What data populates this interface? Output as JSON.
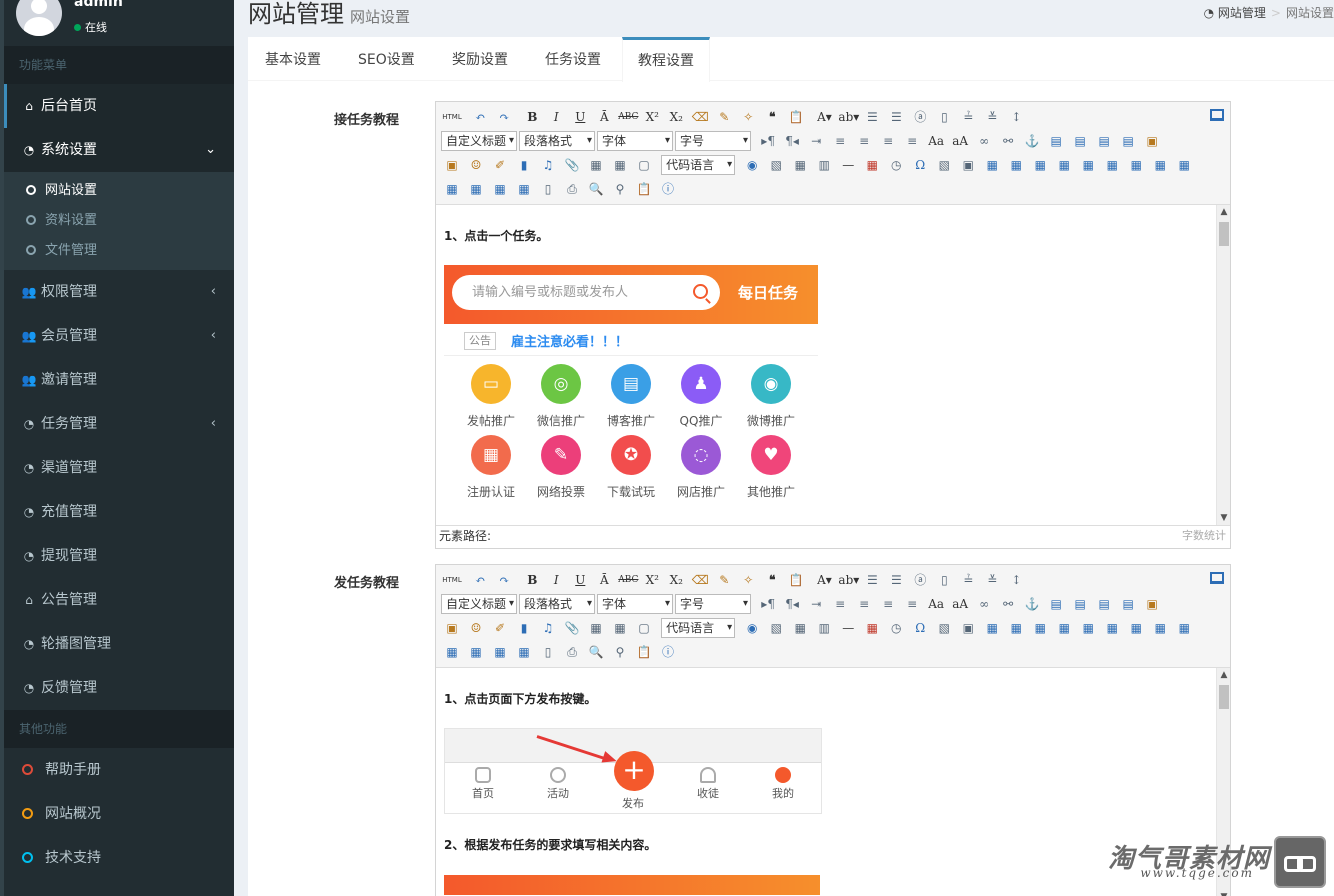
{
  "user": {
    "name": "admin",
    "status": "在线"
  },
  "sidebar": {
    "menu_header": "功能菜单",
    "items": [
      {
        "label": "后台首页",
        "icon": "home-icon"
      },
      {
        "label": "系统设置",
        "icon": "dashboard-icon"
      },
      {
        "label": "权限管理",
        "icon": "users-icon"
      },
      {
        "label": "会员管理",
        "icon": "users-icon"
      },
      {
        "label": "邀请管理",
        "icon": "users-icon"
      },
      {
        "label": "任务管理",
        "icon": "dashboard-icon"
      },
      {
        "label": "渠道管理",
        "icon": "dashboard-icon"
      },
      {
        "label": "充值管理",
        "icon": "dashboard-icon"
      },
      {
        "label": "提现管理",
        "icon": "dashboard-icon"
      },
      {
        "label": "公告管理",
        "icon": "home-icon"
      },
      {
        "label": "轮播图管理",
        "icon": "dashboard-icon"
      },
      {
        "label": "反馈管理",
        "icon": "dashboard-icon"
      }
    ],
    "subitems": [
      "网站设置",
      "资料设置",
      "文件管理"
    ],
    "other_header": "其他功能",
    "other": [
      {
        "label": "帮助手册",
        "color": "#dd4b39"
      },
      {
        "label": "网站概况",
        "color": "#f39c12"
      },
      {
        "label": "技术支持",
        "color": "#00c0ef"
      }
    ]
  },
  "page": {
    "title": "网站管理",
    "subtitle": "网站设置"
  },
  "breadcrumb": {
    "root": "网站管理",
    "current": "网站设置"
  },
  "tabs": [
    "基本设置",
    "SEO设置",
    "奖励设置",
    "任务设置",
    "教程设置"
  ],
  "editor_common": {
    "selects": [
      "自定义标题",
      "段落格式",
      "字体",
      "字号",
      "代码语言"
    ],
    "path_label": "元素路径:",
    "count_label": "字数统计",
    "html_label": "HTML"
  },
  "editor1": {
    "label": "接任务教程",
    "step1": "1、点击一个任务。",
    "search_placeholder": "请输入编号或标题或发布人",
    "daily": "每日任务",
    "notice_tag": "公告",
    "notice_text": "雇主注意必看！！！",
    "grid": [
      {
        "label": "发帖推广",
        "color": "#f7b52c"
      },
      {
        "label": "微信推广",
        "color": "#6cc644"
      },
      {
        "label": "博客推广",
        "color": "#3a9fe6"
      },
      {
        "label": "QQ推广",
        "color": "#8b5cf6"
      },
      {
        "label": "微博推广",
        "color": "#37b8c6"
      },
      {
        "label": "注册认证",
        "color": "#f26b4c"
      },
      {
        "label": "网络投票",
        "color": "#ec3f7a"
      },
      {
        "label": "下载试玩",
        "color": "#f24d4d"
      },
      {
        "label": "网店推广",
        "color": "#9b59d6"
      },
      {
        "label": "其他推广",
        "color": "#f0457a"
      }
    ]
  },
  "editor2": {
    "label": "发任务教程",
    "step1": "1、点击页面下方发布按键。",
    "nav": [
      "首页",
      "活动",
      "发布",
      "收徒",
      "我的"
    ],
    "step2": "2、根据发布任务的要求填写相关内容。"
  },
  "watermark": {
    "text": "淘气哥素材网",
    "url": "www.tqge.com"
  }
}
